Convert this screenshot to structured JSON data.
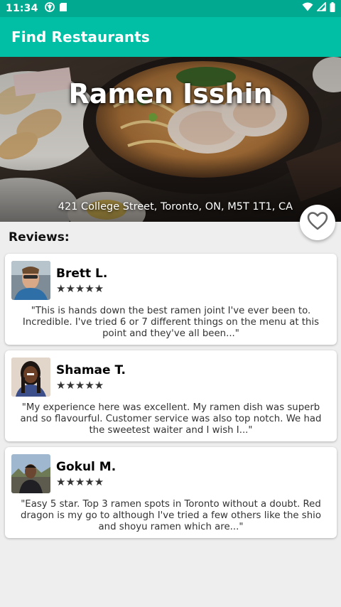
{
  "status_bar": {
    "time": "11:34",
    "left_icons": [
      "location-icon",
      "sd-card-icon"
    ],
    "right_icons": [
      "wifi-icon",
      "signal-icon",
      "battery-icon"
    ]
  },
  "app_bar": {
    "title": "Find Restaurants",
    "background_color": "#00bfa5"
  },
  "restaurant": {
    "name": "Ramen Isshin",
    "address": "421 College Street, Toronto, ON, M5T 1T1, CA",
    "favorite_icon": "heart-outline-icon"
  },
  "reviews": {
    "heading": "Reviews:",
    "items": [
      {
        "name": "Brett L.",
        "rating": 5,
        "stars": "★★★★★",
        "text": "\"This is hands down the best ramen joint I've ever been to. Incredible. I've tried 6 or 7 different things on the menu at this point and they've all been...\""
      },
      {
        "name": "Shamae T.",
        "rating": 5,
        "stars": "★★★★★",
        "text": "\"My experience here was excellent. My ramen dish was superb and so flavourful. Customer service was also top notch. We had the sweetest waiter and I wish I...\""
      },
      {
        "name": "Gokul M.",
        "rating": 5,
        "stars": "★★★★★",
        "text": "\"Easy 5 star. Top 3 ramen spots in Toronto without a doubt. Red dragon is my go to although I've tried a few others like the shio and shoyu ramen which are...\""
      }
    ]
  }
}
